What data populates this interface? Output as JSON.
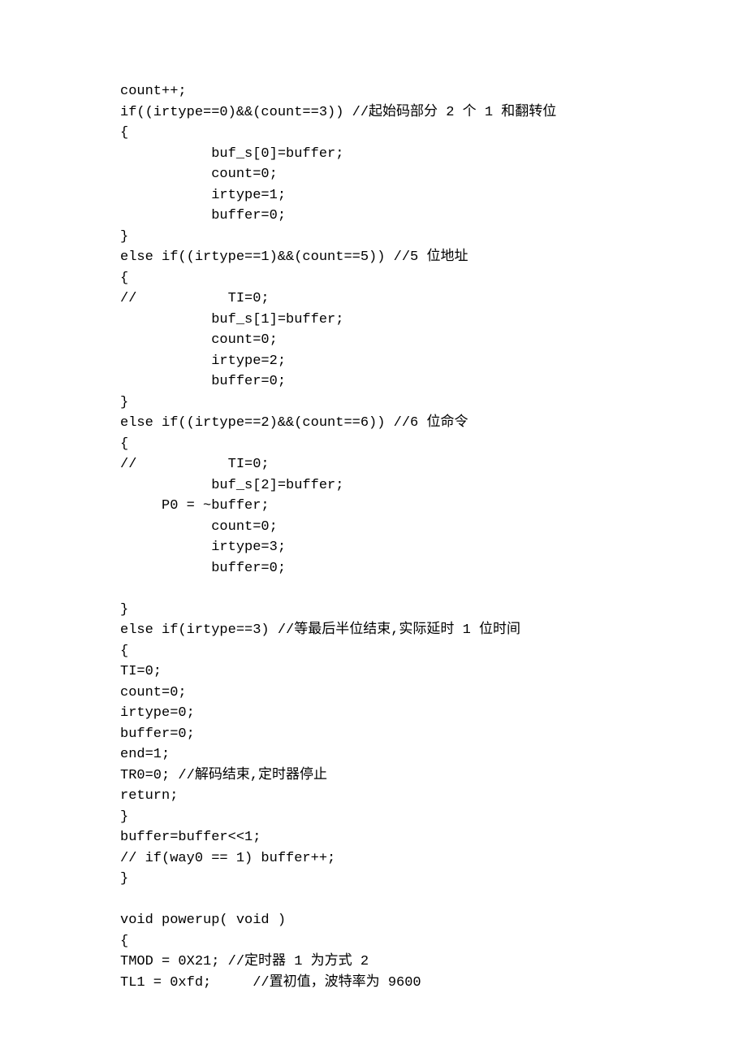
{
  "code": {
    "lines": [
      "count++;",
      "if((irtype==0)&&(count==3)) //起始码部分 2 个 1 和翻转位",
      "{",
      "           buf_s[0]=buffer;",
      "           count=0;",
      "           irtype=1;",
      "           buffer=0;",
      "}",
      "else if((irtype==1)&&(count==5)) //5 位地址",
      "{",
      "//           TI=0;",
      "           buf_s[1]=buffer;",
      "           count=0;",
      "           irtype=2;",
      "           buffer=0;",
      "}",
      "else if((irtype==2)&&(count==6)) //6 位命令",
      "{",
      "//           TI=0;",
      "           buf_s[2]=buffer;",
      "     P0 = ~buffer;",
      "           count=0;",
      "           irtype=3;",
      "           buffer=0;",
      "",
      "}",
      "else if(irtype==3) //等最后半位结束,实际延时 1 位时间",
      "{",
      "TI=0;",
      "count=0;",
      "irtype=0;",
      "buffer=0;",
      "end=1;",
      "TR0=0; //解码结束,定时器停止",
      "return;",
      "}",
      "buffer=buffer<<1;",
      "// if(way0 == 1) buffer++;",
      "}",
      "",
      "void powerup( void )",
      "{",
      "TMOD = 0X21; //定时器 1 为方式 2",
      "TL1 = 0xfd;     //置初值，波特率为 9600"
    ]
  }
}
